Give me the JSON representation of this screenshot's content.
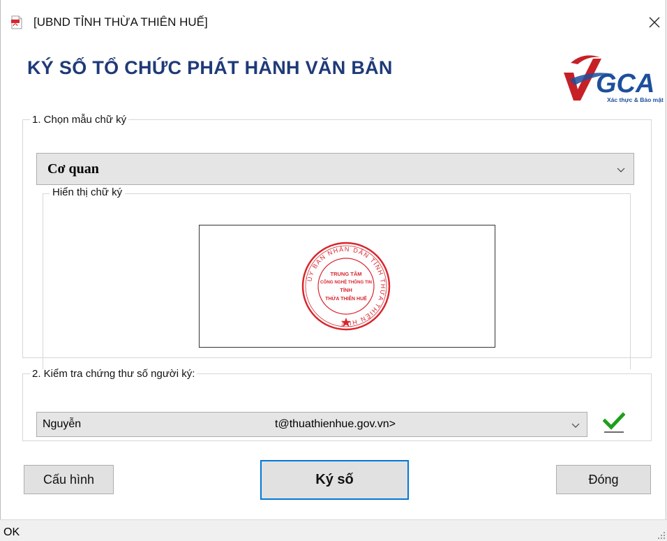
{
  "window": {
    "title": "[UBND TỈNH THỪA THIÊN HUẾ]",
    "close_glyph": "✕"
  },
  "header": {
    "heading": "KÝ SỐ TỔ CHỨC PHÁT HÀNH VĂN BẢN",
    "logo_text": "VGCA",
    "logo_tagline": "Xác thực & Bảo mật"
  },
  "template_section": {
    "legend": "1. Chọn mẫu chữ ký",
    "selected_template": "Cơ quan",
    "preview_legend": "Hiển thị chữ ký",
    "seal": {
      "ring_text": "ỦY BAN NHÂN DÂN TỈNH THỪA THIÊN HUẾ",
      "center_lines": [
        "TRUNG TÂM",
        "CÔNG NGHỆ THÔNG TIN",
        "TỈNH",
        "THỪA THIÊN HUẾ"
      ]
    }
  },
  "certificate_section": {
    "legend": "2. Kiểm tra chứng thư số người ký:",
    "selected_name": "Nguyễn",
    "selected_email": "t@thuathienhue.gov.vn>",
    "status_icon": "checkmark-icon"
  },
  "buttons": {
    "config": "Cấu hình",
    "sign": "Ký số",
    "close": "Đóng"
  },
  "status_bar": {
    "text": "OK"
  },
  "colors": {
    "heading": "#1f3a78",
    "seal": "#d8262e",
    "logo_red": "#c62026",
    "logo_blue": "#1d4f9c",
    "check": "#1e9e1e",
    "focus": "#0078d7"
  }
}
